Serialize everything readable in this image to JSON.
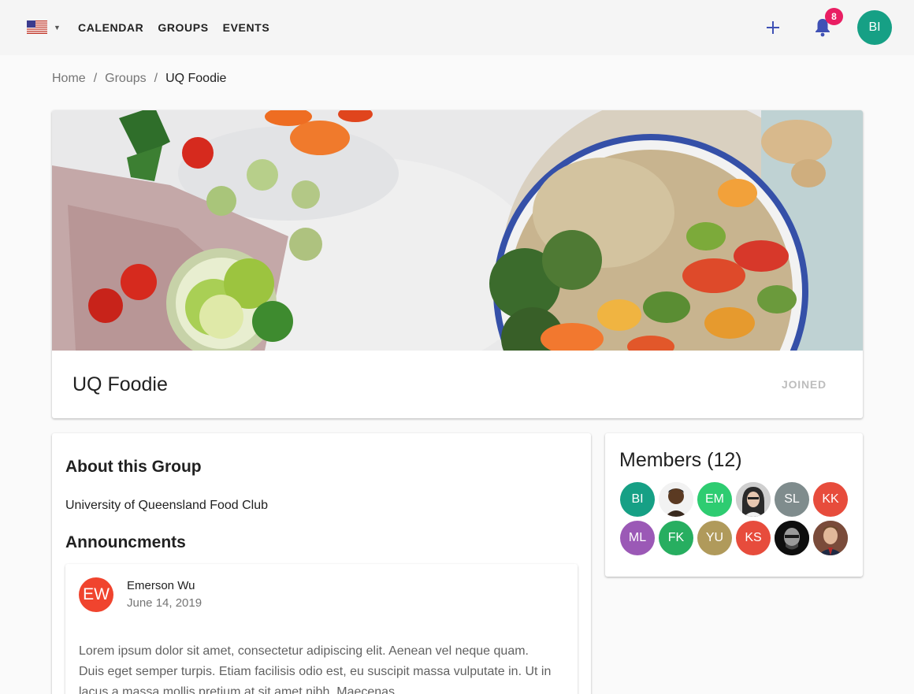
{
  "nav": {
    "items": [
      {
        "key": "calendar",
        "label": "CALENDAR"
      },
      {
        "key": "groups",
        "label": "GROUPS"
      },
      {
        "key": "events",
        "label": "EVENTS"
      }
    ],
    "notification_count": "8",
    "user_initials": "BI",
    "language_icon": "us-flag-icon"
  },
  "breadcrumb": {
    "home": "Home",
    "groups": "Groups",
    "current": "UQ Foodie"
  },
  "group": {
    "title": "UQ Foodie",
    "joined_label": "JOINED",
    "about_title": "About this Group",
    "description": "University of Queensland Food Club",
    "announcements_title": "Announcments"
  },
  "announcement": {
    "initials": "EW",
    "author": "Emerson Wu",
    "date": "June 14, 2019",
    "body": "Lorem ipsum dolor sit amet, consectetur adipiscing elit. Aenean vel neque quam. Duis eget semper turpis. Etiam facilisis odio est, eu suscipit massa vulputate in. Ut in lacus a massa mollis pretium at sit amet nibh. Maecenas"
  },
  "members": {
    "title": "Members (12)",
    "list": [
      {
        "initials": "BI",
        "color": "#16a085",
        "photo": false
      },
      {
        "initials": "",
        "color": "#f0f0f0",
        "photo": true
      },
      {
        "initials": "EM",
        "color": "#2ecc71",
        "photo": false
      },
      {
        "initials": "",
        "color": "#d8d8d8",
        "photo": true
      },
      {
        "initials": "SL",
        "color": "#7f8c8d",
        "photo": false
      },
      {
        "initials": "KK",
        "color": "#e74c3c",
        "photo": false
      },
      {
        "initials": "ML",
        "color": "#9b59b6",
        "photo": false
      },
      {
        "initials": "FK",
        "color": "#27ae60",
        "photo": false
      },
      {
        "initials": "YU",
        "color": "#b09a5b",
        "photo": false
      },
      {
        "initials": "KS",
        "color": "#e74c3c",
        "photo": false
      },
      {
        "initials": "",
        "color": "#111111",
        "photo": true
      },
      {
        "initials": "",
        "color": "#8a5a44",
        "photo": true
      }
    ]
  },
  "colors": {
    "accent": "#3f51b5",
    "badge": "#e91e63",
    "appbar": "#f5f5f5"
  }
}
